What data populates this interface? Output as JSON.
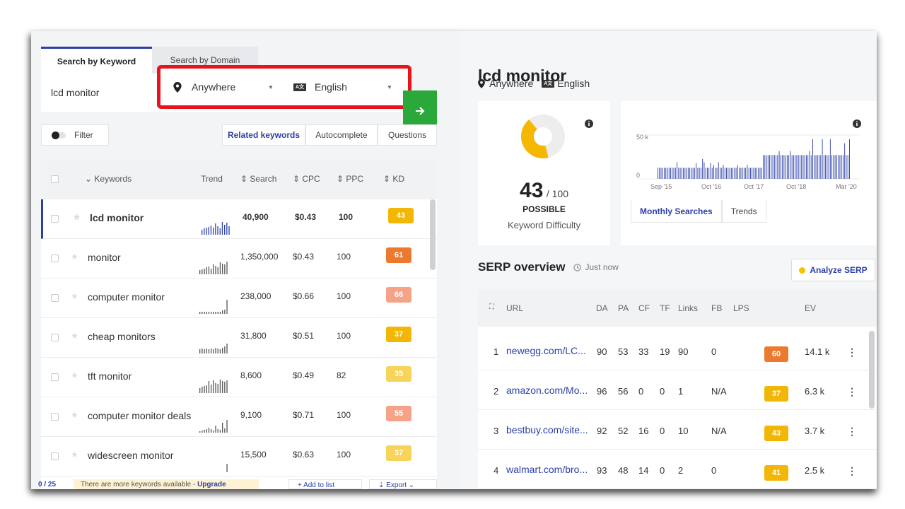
{
  "tabs": {
    "by_keyword": "Search by Keyword",
    "by_domain": "Search by Domain"
  },
  "search": {
    "keyword": "lcd monitor",
    "location": "Anywhere",
    "language": "English",
    "language_badge": "A文"
  },
  "filter_label": "Filter",
  "segments": {
    "related": "Related keywords",
    "autocomplete": "Autocomplete",
    "questions": "Questions"
  },
  "kw_headers": {
    "keywords": "⌄ Keywords",
    "trend": "Trend",
    "search": "⇕ Search",
    "cpc": "⇕ CPC",
    "ppc": "⇕ PPC",
    "kd": "⇕ KD"
  },
  "keywords": [
    {
      "keyword": "lcd monitor",
      "search": "40,900",
      "cpc": "$0.43",
      "ppc": "100",
      "kd": "43",
      "kd_color": "#f2b705",
      "trend": [
        0.35,
        0.45,
        0.5,
        0.55,
        0.65,
        0.5,
        0.8,
        0.6,
        0.45,
        0.9,
        0.7,
        0.85,
        0.6
      ]
    },
    {
      "keyword": "monitor",
      "search": "1,350,000",
      "cpc": "$0.43",
      "ppc": "100",
      "kd": "61",
      "kd_color": "#ec7a2e",
      "trend": [
        0.3,
        0.35,
        0.4,
        0.5,
        0.55,
        0.4,
        0.7,
        0.6,
        0.5,
        0.85,
        0.75,
        0.7,
        0.9
      ]
    },
    {
      "keyword": "computer monitor",
      "search": "238,000",
      "cpc": "$0.66",
      "ppc": "100",
      "kd": "66",
      "kd_color": "#f6a286",
      "trend": [
        0.15,
        0.15,
        0.15,
        0.15,
        0.15,
        0.15,
        0.15,
        0.15,
        0.15,
        0.15,
        0.25,
        0.3,
        1.0
      ]
    },
    {
      "keyword": "cheap monitors",
      "search": "31,800",
      "cpc": "$0.51",
      "ppc": "100",
      "kd": "37",
      "kd_color": "#f2b705",
      "trend": [
        0.3,
        0.35,
        0.3,
        0.35,
        0.3,
        0.35,
        0.3,
        0.4,
        0.35,
        0.3,
        0.4,
        0.5,
        0.7
      ]
    },
    {
      "keyword": "tft monitor",
      "search": "8,600",
      "cpc": "$0.49",
      "ppc": "82",
      "kd": "35",
      "kd_color": "#f7d35a",
      "trend": [
        0.35,
        0.45,
        0.5,
        0.55,
        0.85,
        0.6,
        0.9,
        0.7,
        0.65,
        0.95,
        0.85,
        0.8,
        0.9
      ]
    },
    {
      "keyword": "computer monitor deals",
      "search": "9,100",
      "cpc": "$0.71",
      "ppc": "100",
      "kd": "55",
      "kd_color": "#f6a286",
      "trend": [
        0.1,
        0.15,
        0.2,
        0.25,
        0.35,
        0.25,
        0.15,
        0.5,
        0.25,
        0.2,
        0.7,
        0.3,
        0.9
      ]
    },
    {
      "keyword": "widescreen monitor",
      "search": "15,500",
      "cpc": "$0.63",
      "ppc": "100",
      "kd": "37",
      "kd_color": "#f7d35a",
      "trend": [
        0,
        0,
        0,
        0,
        0,
        0,
        0,
        0,
        0,
        0,
        0,
        0,
        0.6
      ]
    }
  ],
  "footer": {
    "count": "0 / 25",
    "more_text": "There are more keywords available - ",
    "upgrade": "Upgrade",
    "add_to_list": "+  Add to list",
    "export": "⇣  Export  ⌄"
  },
  "right": {
    "title": "lcd monitor",
    "location": "Anywhere",
    "language": "English",
    "kd": {
      "value": "43",
      "out_of": "/ 100",
      "label": "POSSIBLE",
      "caption": "Keyword Difficulty",
      "fraction": 0.43
    },
    "volume": {
      "y_label": "50 k",
      "y_zero": "0",
      "x_labels": [
        "Sep '15",
        "Oct '16",
        "Oct '17",
        "Oct '18",
        "Mar '20"
      ],
      "bars": [
        0.28,
        0.28,
        0.28,
        0.28,
        0.28,
        0.28,
        0.28,
        0.28,
        0.28,
        0.28,
        0.28,
        0.28,
        0.42,
        0.28,
        0.28,
        0.28,
        0.28,
        0.28,
        0.28,
        0.28,
        0.28,
        0.28,
        0.28,
        0.28,
        0.4,
        0.28,
        0.28,
        0.28,
        0.5,
        0.42,
        0.28,
        0.28,
        0.28,
        0.4,
        0.28,
        0.35,
        0.28,
        0.28,
        0.42,
        0.28,
        0.28,
        0.35,
        0.28,
        0.28,
        0.28,
        0.28,
        0.28,
        0.28,
        0.28,
        0.28,
        0.35,
        0.28,
        0.28,
        0.28,
        0.28,
        0.28,
        0.35,
        0.28,
        0.28,
        0.28,
        0.28,
        0.28,
        0.28,
        0.28,
        0.28,
        0.28,
        0.6,
        0.6,
        0.6,
        0.6,
        0.6,
        0.6,
        0.6,
        0.6,
        0.6,
        0.6,
        0.7,
        0.6,
        0.6,
        0.6,
        0.6,
        0.6,
        0.6,
        0.7,
        0.6,
        0.6,
        0.6,
        0.6,
        0.6,
        0.6,
        0.6,
        0.6,
        0.6,
        0.6,
        0.6,
        0.7,
        0.6,
        1.0,
        0.6,
        0.6,
        0.6,
        0.6,
        0.6,
        1.0,
        0.6,
        0.6,
        0.6,
        0.6,
        1.0,
        0.6,
        0.6,
        0.6,
        0.6,
        0.6,
        0.6,
        0.6,
        0.6,
        0.9,
        0.6,
        0.6,
        1.0
      ],
      "tabs": {
        "monthly": "Monthly Searches",
        "trends": "Trends"
      }
    },
    "serp_title": "SERP overview",
    "serp_time": "Just now",
    "analyze": "Analyze SERP",
    "serp_headers": {
      "url": "URL",
      "da": "DA",
      "pa": "PA",
      "cf": "CF",
      "tf": "TF",
      "links": "Links",
      "fb": "FB",
      "lps": "LPS",
      "ev": "EV"
    },
    "serp_rows": [
      {
        "rank": "1",
        "url": "newegg.com/LC...",
        "da": "90",
        "pa": "53",
        "cf": "33",
        "tf": "19",
        "links": "90",
        "fb": "0",
        "lps": "60",
        "lps_color": "#ec7a2e",
        "ev": "14.1 k"
      },
      {
        "rank": "2",
        "url": "amazon.com/Mo...",
        "da": "96",
        "pa": "56",
        "cf": "0",
        "tf": "0",
        "links": "1",
        "fb": "N/A",
        "lps": "37",
        "lps_color": "#f2b705",
        "ev": "6.3 k"
      },
      {
        "rank": "3",
        "url": "bestbuy.com/site...",
        "da": "92",
        "pa": "52",
        "cf": "16",
        "tf": "0",
        "links": "10",
        "fb": "N/A",
        "lps": "43",
        "lps_color": "#f2b705",
        "ev": "3.7 k"
      },
      {
        "rank": "4",
        "url": "walmart.com/bro...",
        "da": "93",
        "pa": "48",
        "cf": "14",
        "tf": "0",
        "links": "2",
        "fb": "0",
        "lps": "41",
        "lps_color": "#f2b705",
        "ev": "2.5 k"
      }
    ]
  },
  "colors": {
    "accent": "#2b3fa8",
    "highlight": "#e8141c",
    "go": "#2aa83a",
    "donut": "#f5b700"
  }
}
